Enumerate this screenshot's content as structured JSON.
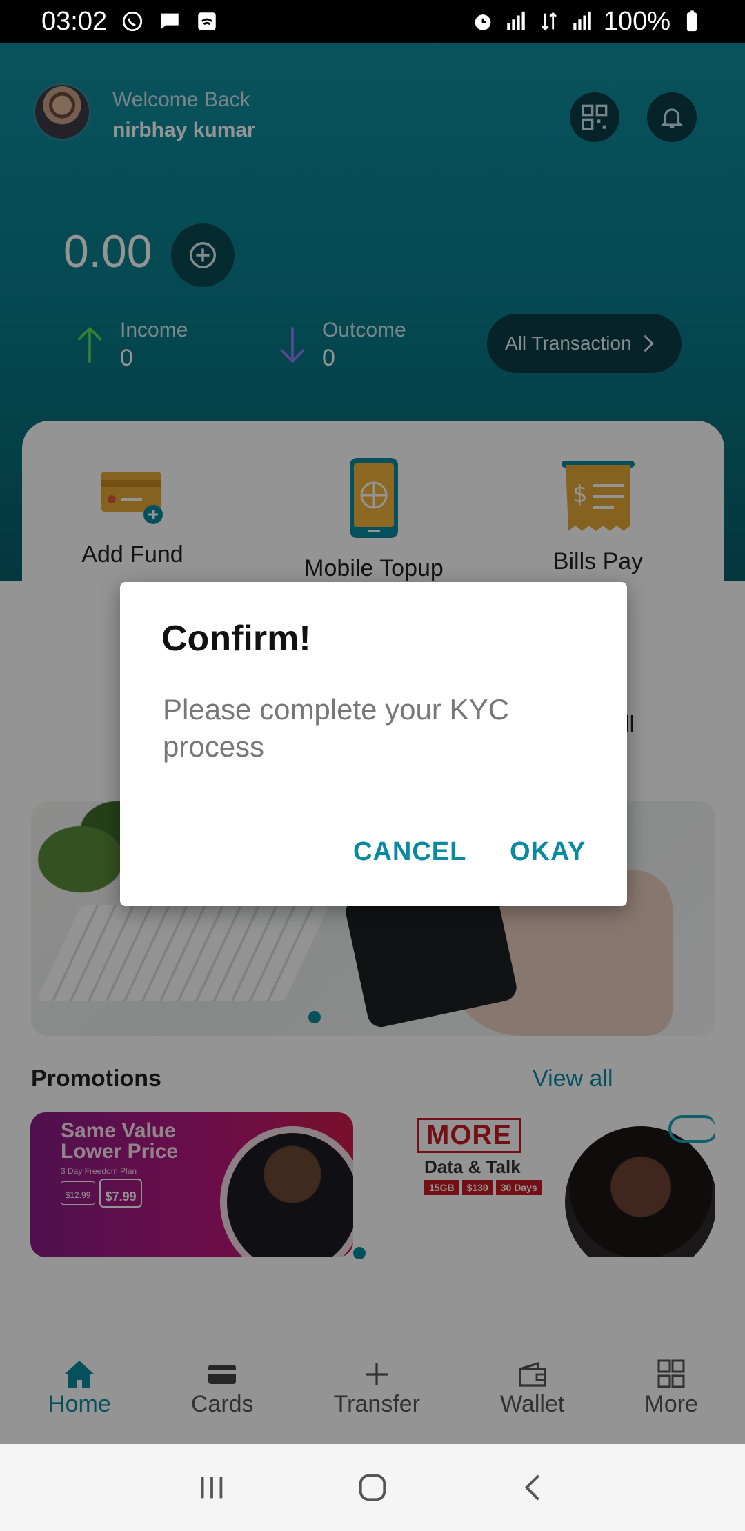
{
  "status_bar": {
    "time": "03:02",
    "battery": "100%"
  },
  "header": {
    "welcome": "Welcome Back",
    "username": "nirbhay kumar",
    "balance": "0.00",
    "income_label": "Income",
    "income_value": "0",
    "outcome_label": "Outcome",
    "outcome_value": "0",
    "all_transaction_label": "All Transaction"
  },
  "services": {
    "items": [
      {
        "label": "Add Fund",
        "icon": "card-plus-icon"
      },
      {
        "label": "Mobile Topup",
        "icon": "phone-globe-icon"
      },
      {
        "label": "Bills Pay",
        "icon": "bill-receipt-icon"
      }
    ],
    "partial_label": "all"
  },
  "promotions": {
    "title": "Promotions",
    "view_all": "View all",
    "promo1": {
      "headline_1": "Same Value",
      "headline_2": "Lower Price",
      "sub": "3 Day Freedom Plan",
      "was_price": "$12.99",
      "now_price": "$7.99"
    },
    "promo2": {
      "headline": "MORE",
      "sub": "Data & Talk",
      "tags": [
        "15GB",
        "$130",
        "30 Days"
      ]
    }
  },
  "bottom_nav": {
    "items": [
      {
        "label": "Home",
        "icon": "home-icon",
        "active": true
      },
      {
        "label": "Cards",
        "icon": "card-icon",
        "active": false
      },
      {
        "label": "Transfer",
        "icon": "plus-icon",
        "active": false
      },
      {
        "label": "Wallet",
        "icon": "wallet-icon",
        "active": false
      },
      {
        "label": "More",
        "icon": "grid-icon",
        "active": false
      }
    ]
  },
  "dialog": {
    "title": "Confirm!",
    "message": "Please complete your KYC process",
    "cancel": "CANCEL",
    "okay": "OKAY"
  },
  "colors": {
    "accent": "#0a8aa0",
    "header_bg": "#0a7d8c",
    "scrim": "rgba(0,0,0,0.42)"
  }
}
